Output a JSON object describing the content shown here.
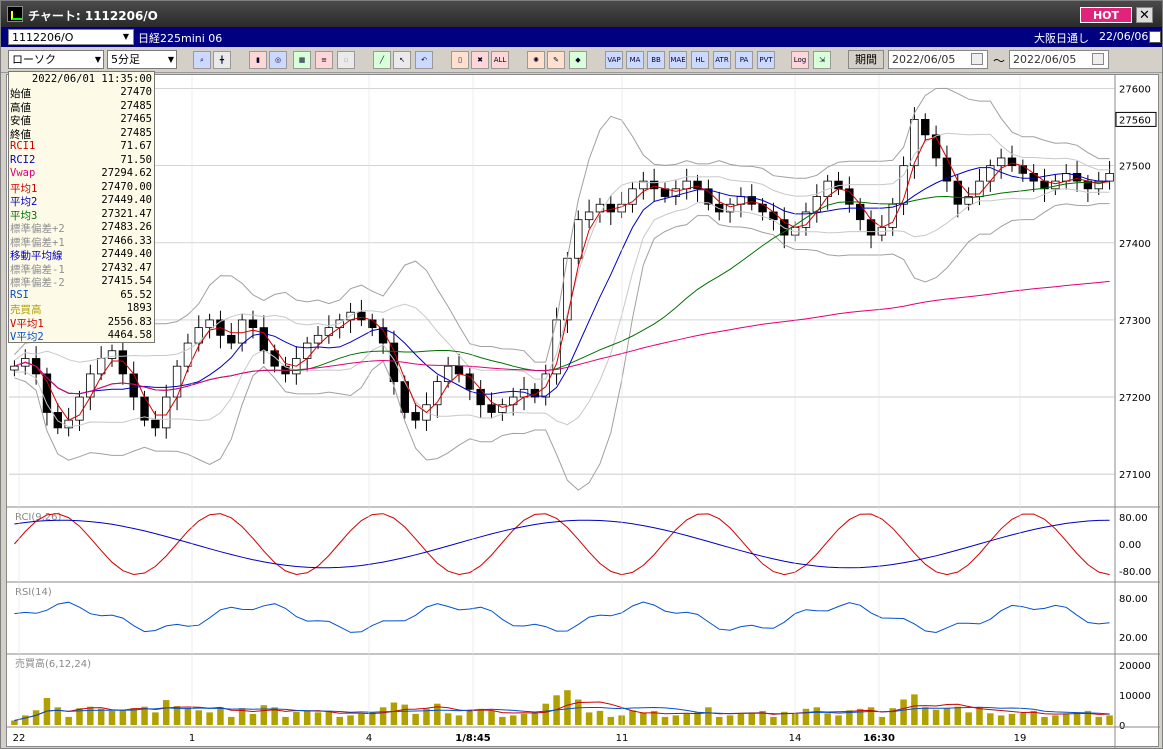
{
  "window": {
    "title": "チャート: 1112206/O",
    "hot_label": "HOT",
    "close_label": "✕"
  },
  "infobar": {
    "symbol": "1112206/O",
    "instrument": "日経225mini 06",
    "market": "大阪日通し",
    "date": "22/06/06"
  },
  "toolbar": {
    "chart_type": "ローソク",
    "interval": "5分足",
    "period_label": "期間",
    "date_from": "2022/06/05",
    "date_to": "2022/06/05",
    "tilde": "〜",
    "indicator_buttons": [
      "VAP",
      "MA",
      "BB",
      "MAE",
      "HL",
      "ATR",
      "PA",
      "PVT",
      "Log"
    ]
  },
  "datapanel": {
    "timestamp": "2022/06/01 11:35:00",
    "rows": [
      {
        "label": "始値",
        "value": "27470",
        "color": "#000000"
      },
      {
        "label": "高値",
        "value": "27485",
        "color": "#000000"
      },
      {
        "label": "安値",
        "value": "27465",
        "color": "#000000"
      },
      {
        "label": "終値",
        "value": "27485",
        "color": "#000000"
      },
      {
        "label": "RCI1",
        "value": "71.67",
        "color": "#d00000"
      },
      {
        "label": "RCI2",
        "value": "71.50",
        "color": "#0000c0"
      },
      {
        "label": "Vwap",
        "value": "27294.62",
        "color": "#e0007a"
      },
      {
        "label": "平均1",
        "value": "27470.00",
        "color": "#d00000"
      },
      {
        "label": "平均2",
        "value": "27449.40",
        "color": "#0000c0"
      },
      {
        "label": "平均3",
        "value": "27321.47",
        "color": "#007000"
      },
      {
        "label": "標準偏差+2",
        "value": "27483.26",
        "color": "#909090"
      },
      {
        "label": "標準偏差+1",
        "value": "27466.33",
        "color": "#909090"
      },
      {
        "label": "移動平均線",
        "value": "27449.40",
        "color": "#0000c0"
      },
      {
        "label": "標準偏差-1",
        "value": "27432.47",
        "color": "#909090"
      },
      {
        "label": "標準偏差-2",
        "value": "27415.54",
        "color": "#909090"
      },
      {
        "label": "RSI",
        "value": "65.52",
        "color": "#0050d0"
      },
      {
        "label": "売買高",
        "value": "1893",
        "color": "#b0a000"
      },
      {
        "label": "V平均1",
        "value": "2556.83",
        "color": "#d00000"
      },
      {
        "label": "V平均2",
        "value": "4464.58",
        "color": "#0050d0"
      }
    ]
  },
  "chart_data": {
    "type": "candlestick",
    "ylim": [
      27060,
      27615
    ],
    "y_ticks": [
      "27600",
      "27500",
      "27400",
      "27300",
      "27200",
      "27100"
    ],
    "current_price_label": "27560",
    "x_tick_labels": [
      "22",
      "1",
      "4",
      "1/8:45",
      "11",
      "14",
      "16:30",
      "19"
    ],
    "series_closes": [
      27240,
      27250,
      27230,
      27180,
      27160,
      27170,
      27200,
      27230,
      27250,
      27260,
      27230,
      27200,
      27170,
      27160,
      27200,
      27240,
      27270,
      27290,
      27300,
      27280,
      27270,
      27300,
      27290,
      27260,
      27240,
      27230,
      27250,
      27270,
      27280,
      27290,
      27300,
      27310,
      27300,
      27290,
      27270,
      27220,
      27180,
      27170,
      27190,
      27220,
      27240,
      27230,
      27210,
      27190,
      27180,
      27190,
      27200,
      27210,
      27200,
      27230,
      27300,
      27380,
      27430,
      27440,
      27450,
      27440,
      27450,
      27470,
      27480,
      27470,
      27460,
      27470,
      27480,
      27470,
      27450,
      27440,
      27450,
      27460,
      27450,
      27440,
      27430,
      27410,
      27420,
      27440,
      27460,
      27480,
      27470,
      27450,
      27430,
      27410,
      27420,
      27450,
      27500,
      27560,
      27540,
      27510,
      27480,
      27450,
      27460,
      27480,
      27500,
      27510,
      27500,
      27490,
      27480,
      27470,
      27480,
      27490,
      27480,
      27470,
      27480,
      27490
    ],
    "rci_panel": {
      "label": "RCI(9,26)",
      "ticks": [
        "80.00",
        "0.00",
        "-80.00"
      ]
    },
    "rsi_panel": {
      "label": "RSI(14)",
      "ticks": [
        "80.00",
        "20.00"
      ]
    },
    "volume_panel": {
      "label": "売買高(6,12,24)",
      "ticks": [
        "20000",
        "10000",
        "0"
      ]
    }
  },
  "colors": {
    "candle_up": "#ffffff",
    "candle_down": "#000000",
    "ma1": "#d00000",
    "ma2": "#0000c0",
    "ma3": "#007000",
    "vwap": "#e0007a",
    "bands": "#a0a0a0",
    "volume": "#b0a000"
  }
}
